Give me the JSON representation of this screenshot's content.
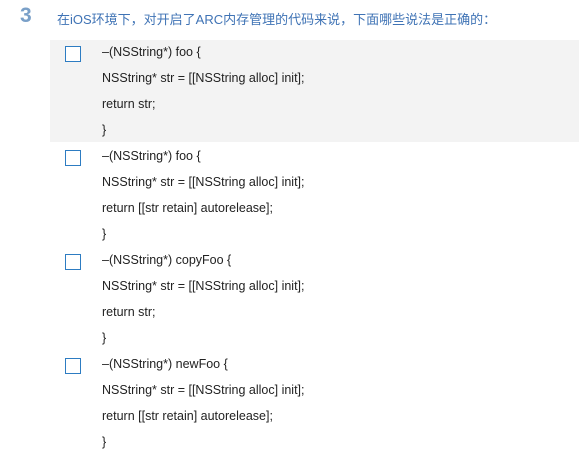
{
  "question": {
    "number": "3",
    "text": "在iOS环境下，对开启了ARC内存管理的代码来说，下面哪些说法是正确的："
  },
  "options": [
    {
      "highlighted": true,
      "checked": false,
      "lines": [
        "–(NSString*) foo {",
        "NSString* str = [[NSString alloc] init];",
        "return str;",
        "}"
      ]
    },
    {
      "highlighted": false,
      "checked": false,
      "lines": [
        "–(NSString*) foo {",
        "NSString* str = [[NSString alloc] init];",
        "return [[str retain] autorelease];",
        "}"
      ]
    },
    {
      "highlighted": false,
      "checked": false,
      "lines": [
        "–(NSString*) copyFoo {",
        "NSString* str = [[NSString alloc] init];",
        "return str;",
        "}"
      ]
    },
    {
      "highlighted": false,
      "checked": false,
      "lines": [
        "–(NSString*) newFoo {",
        "NSString* str = [[NSString alloc] init];",
        "return [[str retain] autorelease];",
        "}"
      ]
    }
  ],
  "colors": {
    "question_number": "#7aa0c8",
    "question_text": "#3f73b5",
    "checkbox_border": "#2d7cc2",
    "highlight_bg": "#f3f3f3"
  }
}
